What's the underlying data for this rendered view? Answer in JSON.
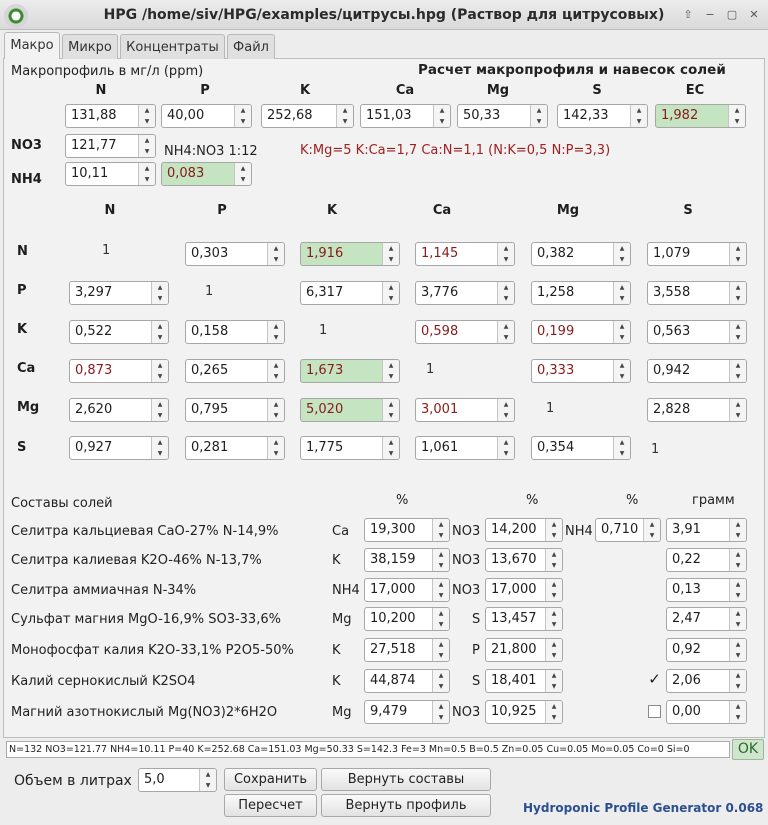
{
  "window": {
    "title": "HPG /home/siv/HPG/examples/цитрусы.hpg (Раствор для цитрусовых)",
    "controls": [
      "⇧",
      "−",
      "▢",
      "✕"
    ]
  },
  "tabs": [
    "Макро",
    "Микро",
    "Концентраты",
    "Файл"
  ],
  "macro": {
    "title": "Макропрофиль в мг/л (ppm)",
    "calc_title": "Расчет макропрофиля и навесок солей",
    "headers": [
      "N",
      "P",
      "K",
      "Ca",
      "Mg",
      "S",
      "EC"
    ],
    "values": [
      "131,88",
      "40,00",
      "252,68",
      "151,03",
      "50,33",
      "142,33",
      "1,982"
    ],
    "no3_label": "NO3",
    "no3_value": "121,77",
    "nh4_label": "NH4",
    "nh4_value": "10,11",
    "ratio_label": "NH4:NO3 1:12",
    "ratio_value": "0,083",
    "ratios_text": "K:Mg=5 K:Ca=1,7 Ca:N=1,1 (N:K=0,5 N:P=3,3)"
  },
  "matrix": {
    "cols": [
      "N",
      "P",
      "K",
      "Ca",
      "Mg",
      "S"
    ],
    "rows": [
      {
        "label": "N",
        "cells": [
          "1",
          "0,303",
          "1,916",
          "1,145",
          "0,382",
          "1,079"
        ]
      },
      {
        "label": "P",
        "cells": [
          "3,297",
          "1",
          "6,317",
          "3,776",
          "1,258",
          "3,558"
        ]
      },
      {
        "label": "K",
        "cells": [
          "0,522",
          "0,158",
          "1",
          "0,598",
          "0,199",
          "0,563"
        ]
      },
      {
        "label": "Ca",
        "cells": [
          "0,873",
          "0,265",
          "1,673",
          "1",
          "0,333",
          "0,942"
        ]
      },
      {
        "label": "Mg",
        "cells": [
          "2,620",
          "0,795",
          "5,020",
          "3,001",
          "1",
          "2,828"
        ]
      },
      {
        "label": "S",
        "cells": [
          "0,927",
          "0,281",
          "1,775",
          "1,061",
          "0,354",
          "1"
        ]
      }
    ]
  },
  "salts": {
    "title": "Составы солей",
    "pct1": "%",
    "pct2": "%",
    "pct3": "%",
    "gram": "грамм",
    "items": [
      {
        "name": "Селитра кальциевая CaO-27% N-14,9%",
        "e1": "Ca",
        "v1": "19,300",
        "e2": "NO3",
        "v2": "14,200",
        "e3": "NH4",
        "v3": "0,710",
        "grams": "3,91"
      },
      {
        "name": "Селитра калиевая K2O-46% N-13,7%",
        "e1": "K",
        "v1": "38,159",
        "e2": "NO3",
        "v2": "13,670",
        "grams": "0,22"
      },
      {
        "name": "Селитра аммиачная N-34%",
        "e1": "NH4",
        "v1": "17,000",
        "e2": "NO3",
        "v2": "17,000",
        "grams": "0,13"
      },
      {
        "name": "Сульфат магния MgO-16,9% SO3-33,6%",
        "e1": "Mg",
        "v1": "10,200",
        "e2": "S",
        "v2": "13,457",
        "grams": "2,47"
      },
      {
        "name": "Монофосфат калия K2O-33,1% P2O5-50%",
        "e1": "K",
        "v1": "27,518",
        "e2": "P",
        "v2": "21,800",
        "grams": "0,92"
      },
      {
        "name": "Калий сернокислый K2SO4",
        "e1": "K",
        "v1": "44,874",
        "e2": "S",
        "v2": "18,401",
        "grams": "2,06",
        "checked": "✓"
      },
      {
        "name": "Магний азотнокислый Mg(NO3)2*6H2O",
        "e1": "Mg",
        "v1": "9,479",
        "e2": "NO3",
        "v2": "10,925",
        "grams": "0,00",
        "checked": ""
      }
    ]
  },
  "status": {
    "text": "N=132 NO3=121.77 NH4=10.11 P=40 K=252.68 Ca=151.03 Mg=50.33 S=142.3 Fe=3 Mn=0.5 B=0.5 Zn=0.05 Cu=0.05 Mo=0.05 Co=0 Si=0",
    "ok": "OK"
  },
  "bottom": {
    "volume_label": "Объем в литрах",
    "volume_value": "5,0",
    "save": "Сохранить",
    "restore_salts": "Вернуть составы",
    "recalc": "Пересчет",
    "restore_profile": "Вернуть профиль",
    "brand": "Hydroponic Profile Generator 0.068"
  }
}
